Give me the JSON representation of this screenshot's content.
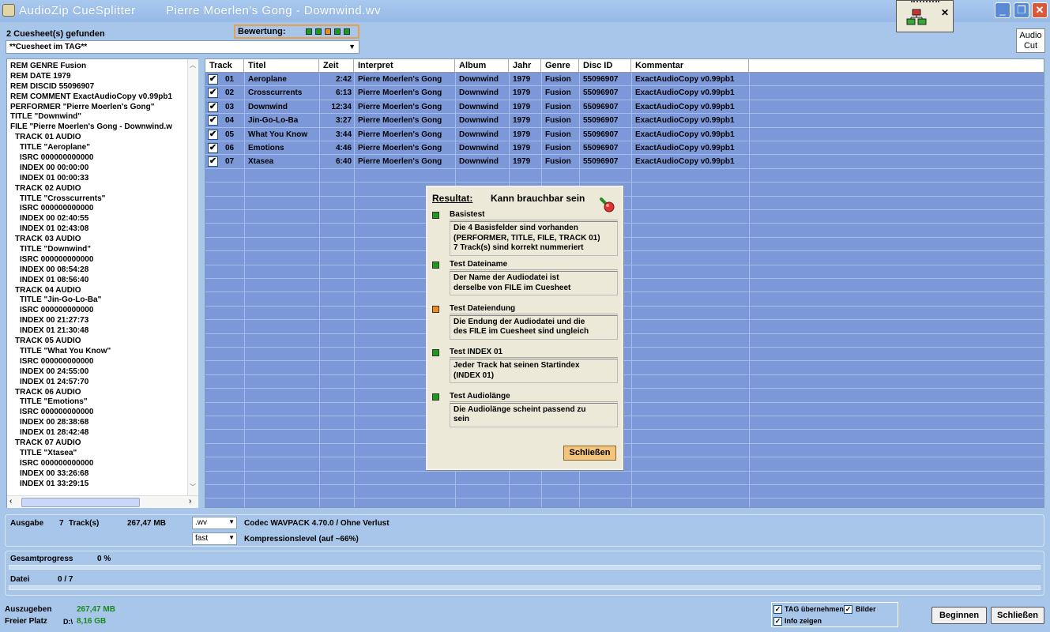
{
  "window": {
    "app_title": "AudioZip CueSplitter",
    "doc_title": "Pierre Moerlen's Gong - Downwind.wv",
    "min": "_",
    "max": "❐",
    "close": "✕",
    "toolwin_close": "✕"
  },
  "header": {
    "cuesheet_found": "2   Cuesheet(s) gefunden",
    "bewertung_label": "Bewertung:",
    "rating_dots": [
      "#1c9a1c",
      "#1c9a1c",
      "#f08a1c",
      "#1c9a1c",
      "#1c9a1c"
    ],
    "cuesheet_select": "**Cuesheet im TAG**",
    "audio_cut_line1": "Audio",
    "audio_cut_line2": "Cut"
  },
  "cue_lines": [
    {
      "t": "REM GENRE Fusion",
      "i": 0
    },
    {
      "t": "REM DATE 1979",
      "i": 0
    },
    {
      "t": "REM DISCID 55096907",
      "i": 0
    },
    {
      "t": "REM COMMENT ExactAudioCopy v0.99pb1",
      "i": 0
    },
    {
      "t": "PERFORMER \"Pierre Moerlen's Gong\"",
      "i": 0
    },
    {
      "t": "TITLE \"Downwind\"",
      "i": 0
    },
    {
      "t": "FILE \"Pierre Moerlen's Gong - Downwind.w",
      "i": 0
    },
    {
      "t": "TRACK 01 AUDIO",
      "i": 1
    },
    {
      "t": "TITLE \"Aeroplane\"",
      "i": 2
    },
    {
      "t": "ISRC 000000000000",
      "i": 2
    },
    {
      "t": "INDEX 00 00:00:00",
      "i": 2
    },
    {
      "t": "INDEX 01 00:00:33",
      "i": 2
    },
    {
      "t": "TRACK 02 AUDIO",
      "i": 1
    },
    {
      "t": "TITLE \"Crosscurrents\"",
      "i": 2
    },
    {
      "t": "ISRC 000000000000",
      "i": 2
    },
    {
      "t": "INDEX 00 02:40:55",
      "i": 2
    },
    {
      "t": "INDEX 01 02:43:08",
      "i": 2
    },
    {
      "t": "TRACK 03 AUDIO",
      "i": 1
    },
    {
      "t": "TITLE \"Downwind\"",
      "i": 2
    },
    {
      "t": "ISRC 000000000000",
      "i": 2
    },
    {
      "t": "INDEX 00 08:54:28",
      "i": 2
    },
    {
      "t": "INDEX 01 08:56:40",
      "i": 2
    },
    {
      "t": "TRACK 04 AUDIO",
      "i": 1
    },
    {
      "t": "TITLE \"Jin-Go-Lo-Ba\"",
      "i": 2
    },
    {
      "t": "ISRC 000000000000",
      "i": 2
    },
    {
      "t": "INDEX 00 21:27:73",
      "i": 2
    },
    {
      "t": "INDEX 01 21:30:48",
      "i": 2
    },
    {
      "t": "TRACK 05 AUDIO",
      "i": 1
    },
    {
      "t": "TITLE \"What You Know\"",
      "i": 2
    },
    {
      "t": "ISRC 000000000000",
      "i": 2
    },
    {
      "t": "INDEX 00 24:55:00",
      "i": 2
    },
    {
      "t": "INDEX 01 24:57:70",
      "i": 2
    },
    {
      "t": "TRACK 06 AUDIO",
      "i": 1
    },
    {
      "t": "TITLE \"Emotions\"",
      "i": 2
    },
    {
      "t": "ISRC 000000000000",
      "i": 2
    },
    {
      "t": "INDEX 00 28:38:68",
      "i": 2
    },
    {
      "t": "INDEX 01 28:42:48",
      "i": 2
    },
    {
      "t": "TRACK 07 AUDIO",
      "i": 1
    },
    {
      "t": "TITLE \"Xtasea\"",
      "i": 2
    },
    {
      "t": "ISRC 000000000000",
      "i": 2
    },
    {
      "t": "INDEX 00 33:26:68",
      "i": 2
    },
    {
      "t": "INDEX 01 33:29:15",
      "i": 2
    }
  ],
  "table": {
    "columns": [
      "Track",
      "Titel",
      "Zeit",
      "Interpret",
      "Album",
      "Jahr",
      "Genre",
      "Disc ID",
      "Kommentar"
    ],
    "rows": [
      {
        "checked": true,
        "track": "01",
        "title": "Aeroplane",
        "time": "2:42",
        "artist": "Pierre Moerlen's Gong",
        "album": "Downwind",
        "year": "1979",
        "genre": "Fusion",
        "discid": "55096907",
        "comment": "ExactAudioCopy v0.99pb1"
      },
      {
        "checked": true,
        "track": "02",
        "title": "Crosscurrents",
        "time": "6:13",
        "artist": "Pierre Moerlen's Gong",
        "album": "Downwind",
        "year": "1979",
        "genre": "Fusion",
        "discid": "55096907",
        "comment": "ExactAudioCopy v0.99pb1"
      },
      {
        "checked": true,
        "track": "03",
        "title": "Downwind",
        "time": "12:34",
        "artist": "Pierre Moerlen's Gong",
        "album": "Downwind",
        "year": "1979",
        "genre": "Fusion",
        "discid": "55096907",
        "comment": "ExactAudioCopy v0.99pb1"
      },
      {
        "checked": true,
        "track": "04",
        "title": "Jin-Go-Lo-Ba",
        "time": "3:27",
        "artist": "Pierre Moerlen's Gong",
        "album": "Downwind",
        "year": "1979",
        "genre": "Fusion",
        "discid": "55096907",
        "comment": "ExactAudioCopy v0.99pb1"
      },
      {
        "checked": true,
        "track": "05",
        "title": "What You Know",
        "time": "3:44",
        "artist": "Pierre Moerlen's Gong",
        "album": "Downwind",
        "year": "1979",
        "genre": "Fusion",
        "discid": "55096907",
        "comment": "ExactAudioCopy v0.99pb1"
      },
      {
        "checked": true,
        "track": "06",
        "title": "Emotions",
        "time": "4:46",
        "artist": "Pierre Moerlen's Gong",
        "album": "Downwind",
        "year": "1979",
        "genre": "Fusion",
        "discid": "55096907",
        "comment": "ExactAudioCopy v0.99pb1"
      },
      {
        "checked": true,
        "track": "07",
        "title": "Xtasea",
        "time": "6:40",
        "artist": "Pierre Moerlen's Gong",
        "album": "Downwind",
        "year": "1979",
        "genre": "Fusion",
        "discid": "55096907",
        "comment": "ExactAudioCopy v0.99pb1"
      }
    ]
  },
  "result": {
    "label": "Resultat:",
    "value": "Kann brauchbar sein",
    "close_label": "Schließen",
    "tests": [
      {
        "title": "Basistest",
        "color": "#1c9a1c",
        "lines": [
          "Die 4 Basisfelder sind vorhanden",
          "(PERFORMER, TITLE, FILE, TRACK 01)",
          "7 Track(s) sind korrekt nummeriert"
        ]
      },
      {
        "title": "Test Dateiname",
        "color": "#1c9a1c",
        "lines": [
          "Der Name der Audiodatei ist",
          "derselbe von FILE im Cuesheet"
        ]
      },
      {
        "title": "Test Dateiendung",
        "color": "#f08a1c",
        "lines": [
          "Die Endung der Audiodatei und die",
          "des FILE im Cuesheet sind ungleich"
        ]
      },
      {
        "title": "Test INDEX 01",
        "color": "#1c9a1c",
        "lines": [
          "Jeder Track hat seinen Startindex",
          "(INDEX 01)"
        ]
      },
      {
        "title": "Test Audiolänge",
        "color": "#1c9a1c",
        "lines": [
          "Die Audiolänge scheint passend zu",
          "sein"
        ]
      }
    ]
  },
  "output": {
    "label": "Ausgabe",
    "track_count": "7",
    "track_suffix": "Track(s)",
    "size": "267,47 MB",
    "format": ".wv",
    "codec": "Codec WAVPACK 4.70.0 / Ohne Verlust",
    "compression": "fast",
    "compression_label": "Kompressionslevel (auf ~66%)"
  },
  "progress": {
    "total_label": "Gesamtprogress",
    "total_value": "0 %",
    "total_fraction": 0,
    "file_label": "Datei",
    "file_value": "0 / 7",
    "file_fraction": 0
  },
  "footer": {
    "out_label": "Auszugeben",
    "out_value": "267,47 MB",
    "free_label": "Freier Platz",
    "drive": "D:\\",
    "free_value": "8,16 GB",
    "opt_tag": "TAG übernehmen",
    "opt_bilder": "Bilder",
    "opt_info": "Info zeigen",
    "check_mark": "✓",
    "begin": "Beginnen",
    "close": "Schließen"
  }
}
